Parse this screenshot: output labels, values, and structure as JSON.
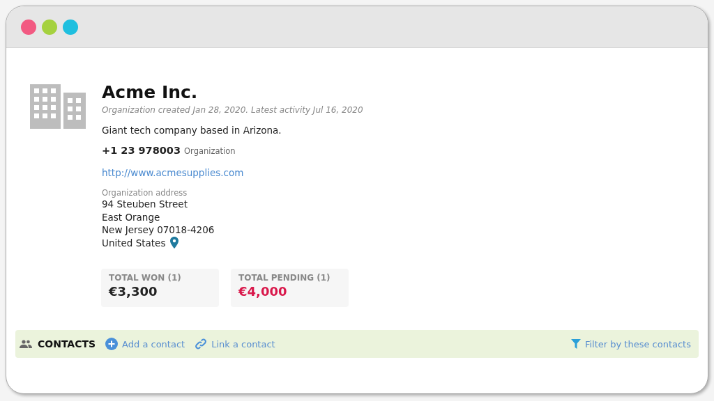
{
  "window": {
    "controls": [
      {
        "color": "#f25a82"
      },
      {
        "color": "#a5d13f"
      },
      {
        "color": "#1fbfdf"
      }
    ]
  },
  "organization": {
    "name": "Acme Inc.",
    "meta": "Organization created Jan 28, 2020. Latest activity Jul 16, 2020",
    "description": "Giant tech company based in Arizona.",
    "phone": "+1 23 978003",
    "phone_type": "Organization",
    "website": "http://www.acmesupplies.com",
    "address_label": "Organization address",
    "address_lines": [
      "94 Steuben Street",
      "East Orange",
      "New Jersey 07018-4206",
      "United States"
    ]
  },
  "totals": [
    {
      "label": "TOTAL WON (1)",
      "value": "€3,300",
      "kind": "won"
    },
    {
      "label": "TOTAL PENDING (1)",
      "value": "€4,000",
      "kind": "pending"
    }
  ],
  "contacts_bar": {
    "title": "CONTACTS",
    "actions": [
      {
        "label": "Add a contact",
        "kind": "add"
      },
      {
        "label": "Link a contact",
        "kind": "link"
      }
    ],
    "filter": "Filter by these contacts"
  }
}
